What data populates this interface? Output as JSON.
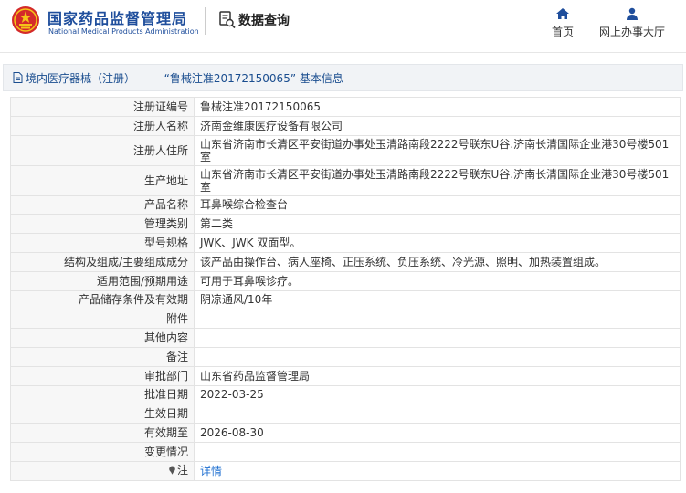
{
  "header": {
    "brand_cn": "国家药品监督管理局",
    "brand_en": "National Medical Products Administration",
    "data_query": "数据查询",
    "nav": [
      {
        "label": "首页",
        "icon": "home-icon"
      },
      {
        "label": "网上办事大厅",
        "icon": "user-icon"
      }
    ]
  },
  "colors": {
    "brand_blue": "#1f4e9c",
    "emblem_red": "#d42a2a",
    "emblem_gold": "#f5c518",
    "link_blue": "#1e6fd0",
    "title_text": "#1a4d8f"
  },
  "title": "境内医疗器械（注册） —— “鲁械注准20172150065” 基本信息",
  "rows": [
    {
      "label": "注册证编号",
      "value": "鲁械注准20172150065"
    },
    {
      "label": "注册人名称",
      "value": "济南金维康医疗设备有限公司"
    },
    {
      "label": "注册人住所",
      "value": "山东省济南市长清区平安街道办事处玉清路南段2222号联东U谷.济南长清国际企业港30号楼501室"
    },
    {
      "label": "生产地址",
      "value": "山东省济南市长清区平安街道办事处玉清路南段2222号联东U谷.济南长清国际企业港30号楼501室"
    },
    {
      "label": "产品名称",
      "value": "耳鼻喉综合检查台"
    },
    {
      "label": "管理类别",
      "value": "第二类"
    },
    {
      "label": "型号规格",
      "value": "JWK、JWK 双面型。"
    },
    {
      "label": "结构及组成/主要组成成分",
      "value": "该产品由操作台、病人座椅、正压系统、负压系统、冷光源、照明、加热装置组成。"
    },
    {
      "label": "适用范围/预期用途",
      "value": "可用于耳鼻喉诊疗。"
    },
    {
      "label": "产品储存条件及有效期",
      "value": "阴凉通风/10年"
    },
    {
      "label": "附件",
      "value": ""
    },
    {
      "label": "其他内容",
      "value": ""
    },
    {
      "label": "备注",
      "value": ""
    },
    {
      "label": "审批部门",
      "value": "山东省药品监督管理局"
    },
    {
      "label": "批准日期",
      "value": "2022-03-25"
    },
    {
      "label": "生效日期",
      "value": ""
    },
    {
      "label": "有效期至",
      "value": "2026-08-30"
    },
    {
      "label": "变更情况",
      "value": ""
    }
  ],
  "note_row": {
    "label": "注",
    "icon": "pin-icon",
    "link": "详情"
  }
}
